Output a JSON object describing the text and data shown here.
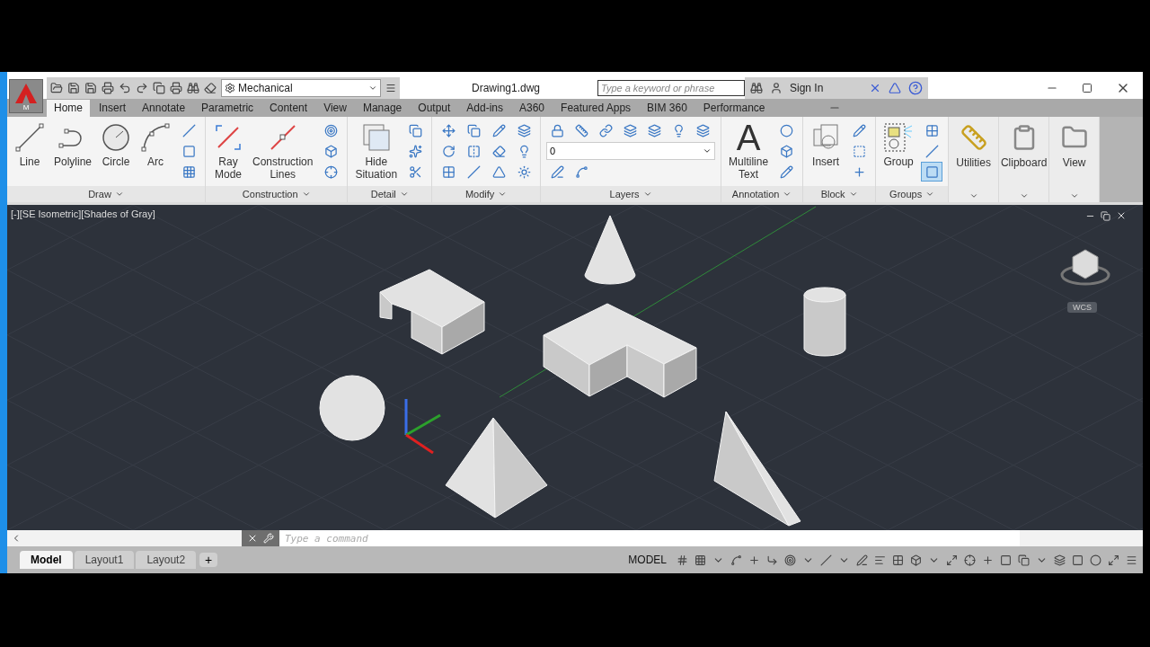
{
  "app_button": {
    "label": "M"
  },
  "quick_access": {
    "workspace": "Mechanical"
  },
  "document_title": "Drawing1.dwg",
  "search": {
    "placeholder": "Type a keyword or phrase"
  },
  "account": {
    "label": "Sign In"
  },
  "tabs": [
    {
      "label": "Home",
      "selected": true
    },
    {
      "label": "Insert",
      "selected": false
    },
    {
      "label": "Annotate",
      "selected": false
    },
    {
      "label": "Parametric",
      "selected": false
    },
    {
      "label": "Content",
      "selected": false
    },
    {
      "label": "View",
      "selected": false
    },
    {
      "label": "Manage",
      "selected": false
    },
    {
      "label": "Output",
      "selected": false
    },
    {
      "label": "Add-ins",
      "selected": false
    },
    {
      "label": "A360",
      "selected": false
    },
    {
      "label": "Featured Apps",
      "selected": false
    },
    {
      "label": "BIM 360",
      "selected": false
    },
    {
      "label": "Performance",
      "selected": false
    }
  ],
  "panels": [
    {
      "kind": "full",
      "title": "Draw",
      "tools": [
        {
          "kind": "large",
          "label": "Line"
        },
        {
          "kind": "large",
          "label": "Polyline"
        },
        {
          "kind": "large",
          "label": "Circle"
        },
        {
          "kind": "large",
          "label": "Arc"
        },
        {
          "kind": "small",
          "on": false
        },
        {
          "kind": "small",
          "on": false
        },
        {
          "kind": "small",
          "on": false
        }
      ]
    },
    {
      "kind": "full",
      "title": "Construction",
      "tools": [
        {
          "kind": "large",
          "label": "Ray\nMode"
        },
        {
          "kind": "large",
          "label": "Construction\nLines"
        },
        {
          "kind": "small",
          "on": false
        },
        {
          "kind": "small",
          "on": false
        },
        {
          "kind": "small",
          "on": false
        }
      ]
    },
    {
      "kind": "full",
      "title": "Detail",
      "tools": [
        {
          "kind": "large",
          "label": "Hide\nSituation"
        },
        {
          "kind": "small",
          "on": false
        },
        {
          "kind": "small",
          "on": false
        },
        {
          "kind": "small",
          "on": false
        }
      ]
    },
    {
      "kind": "full",
      "title": "Modify",
      "tools": [
        {
          "kind": "small",
          "on": false
        },
        {
          "kind": "small",
          "on": false
        },
        {
          "kind": "small",
          "on": false
        },
        {
          "kind": "small",
          "on": false
        },
        {
          "kind": "small",
          "on": false
        },
        {
          "kind": "small",
          "on": false
        },
        {
          "kind": "small",
          "on": false
        },
        {
          "kind": "small",
          "on": false
        },
        {
          "kind": "small",
          "on": false
        },
        {
          "kind": "small",
          "on": false
        },
        {
          "kind": "small",
          "on": false
        },
        {
          "kind": "small",
          "on": false
        }
      ]
    },
    {
      "kind": "layers",
      "title": "Layers",
      "tools": [
        {
          "kind": "small",
          "on": false
        },
        {
          "kind": "small",
          "on": false
        },
        {
          "kind": "small",
          "on": false
        },
        {
          "kind": "small",
          "on": false
        },
        {
          "kind": "small",
          "on": false
        },
        {
          "kind": "small",
          "on": false
        },
        {
          "kind": "small",
          "on": false
        },
        {
          "kind": "dropdown",
          "value": "0"
        },
        {
          "kind": "small",
          "on": false
        },
        {
          "kind": "small",
          "on": false
        }
      ]
    },
    {
      "kind": "full",
      "title": "Annotation",
      "tools": [
        {
          "kind": "large",
          "label": "Multiline\nText",
          "glyph": "A"
        },
        {
          "kind": "small",
          "on": false
        },
        {
          "kind": "small",
          "on": false
        },
        {
          "kind": "small",
          "on": false
        }
      ]
    },
    {
      "kind": "full",
      "title": "Block",
      "tools": [
        {
          "kind": "large",
          "label": "Insert"
        },
        {
          "kind": "small",
          "on": false
        },
        {
          "kind": "small",
          "on": false
        },
        {
          "kind": "small",
          "on": false
        }
      ]
    },
    {
      "kind": "full",
      "title": "Groups",
      "tools": [
        {
          "kind": "large",
          "label": "Group"
        },
        {
          "kind": "small",
          "on": false
        },
        {
          "kind": "small",
          "on": false
        },
        {
          "kind": "small",
          "on": true
        }
      ]
    },
    {
      "kind": "collapsed",
      "title": "Utilities"
    },
    {
      "kind": "collapsed",
      "title": "Clipboard"
    },
    {
      "kind": "collapsed",
      "title": "View"
    }
  ],
  "viewport": {
    "label": "[-][SE Isometric][Shades of Gray]",
    "coordinate_system": "WCS"
  },
  "command_line": {
    "placeholder": "Type a command"
  },
  "layout_tabs": [
    {
      "label": "Model",
      "selected": true
    },
    {
      "label": "Layout1",
      "selected": false
    },
    {
      "label": "Layout2",
      "selected": false
    }
  ],
  "add_layout": "+",
  "status_bar": {
    "space": "MODEL"
  }
}
